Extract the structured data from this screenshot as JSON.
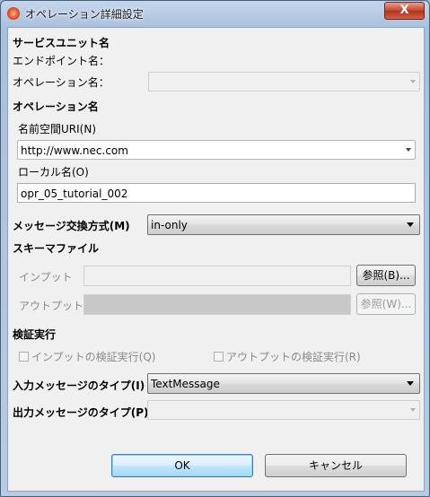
{
  "window": {
    "title": "オペレーション詳細設定",
    "close_label": "X"
  },
  "service_unit": {
    "heading": "サービスユニット名",
    "endpoint_label": "エンドポイント名："
  },
  "operation_name": {
    "label": "オペレーション名：",
    "value": ""
  },
  "operation": {
    "heading": "オペレーション名",
    "namespace_label": "名前空間URI(N)",
    "namespace_value": "http://www.nec.com",
    "local_name_label": "ローカル名(O)",
    "local_name_value": "opr_05_tutorial_002"
  },
  "exchange": {
    "label": "メッセージ交換方式(M)",
    "value": "in-only"
  },
  "schema": {
    "heading": "スキーマファイル",
    "input_label": "インプット",
    "input_value": "",
    "input_browse": "参照(B)...",
    "output_label": "アウトプット",
    "output_value": "",
    "output_browse": "参照(W)..."
  },
  "validation": {
    "heading": "検証実行",
    "input_check": "インプットの検証実行(Q)",
    "output_check": "アウトプットの検証実行(R)"
  },
  "input_msg_type": {
    "label": "入力メッセージのタイプ(I)",
    "value": "TextMessage"
  },
  "output_msg_type": {
    "label": "出力メッセージのタイプ(P)",
    "value": ""
  },
  "buttons": {
    "ok": "OK",
    "cancel": "キャンセル"
  }
}
